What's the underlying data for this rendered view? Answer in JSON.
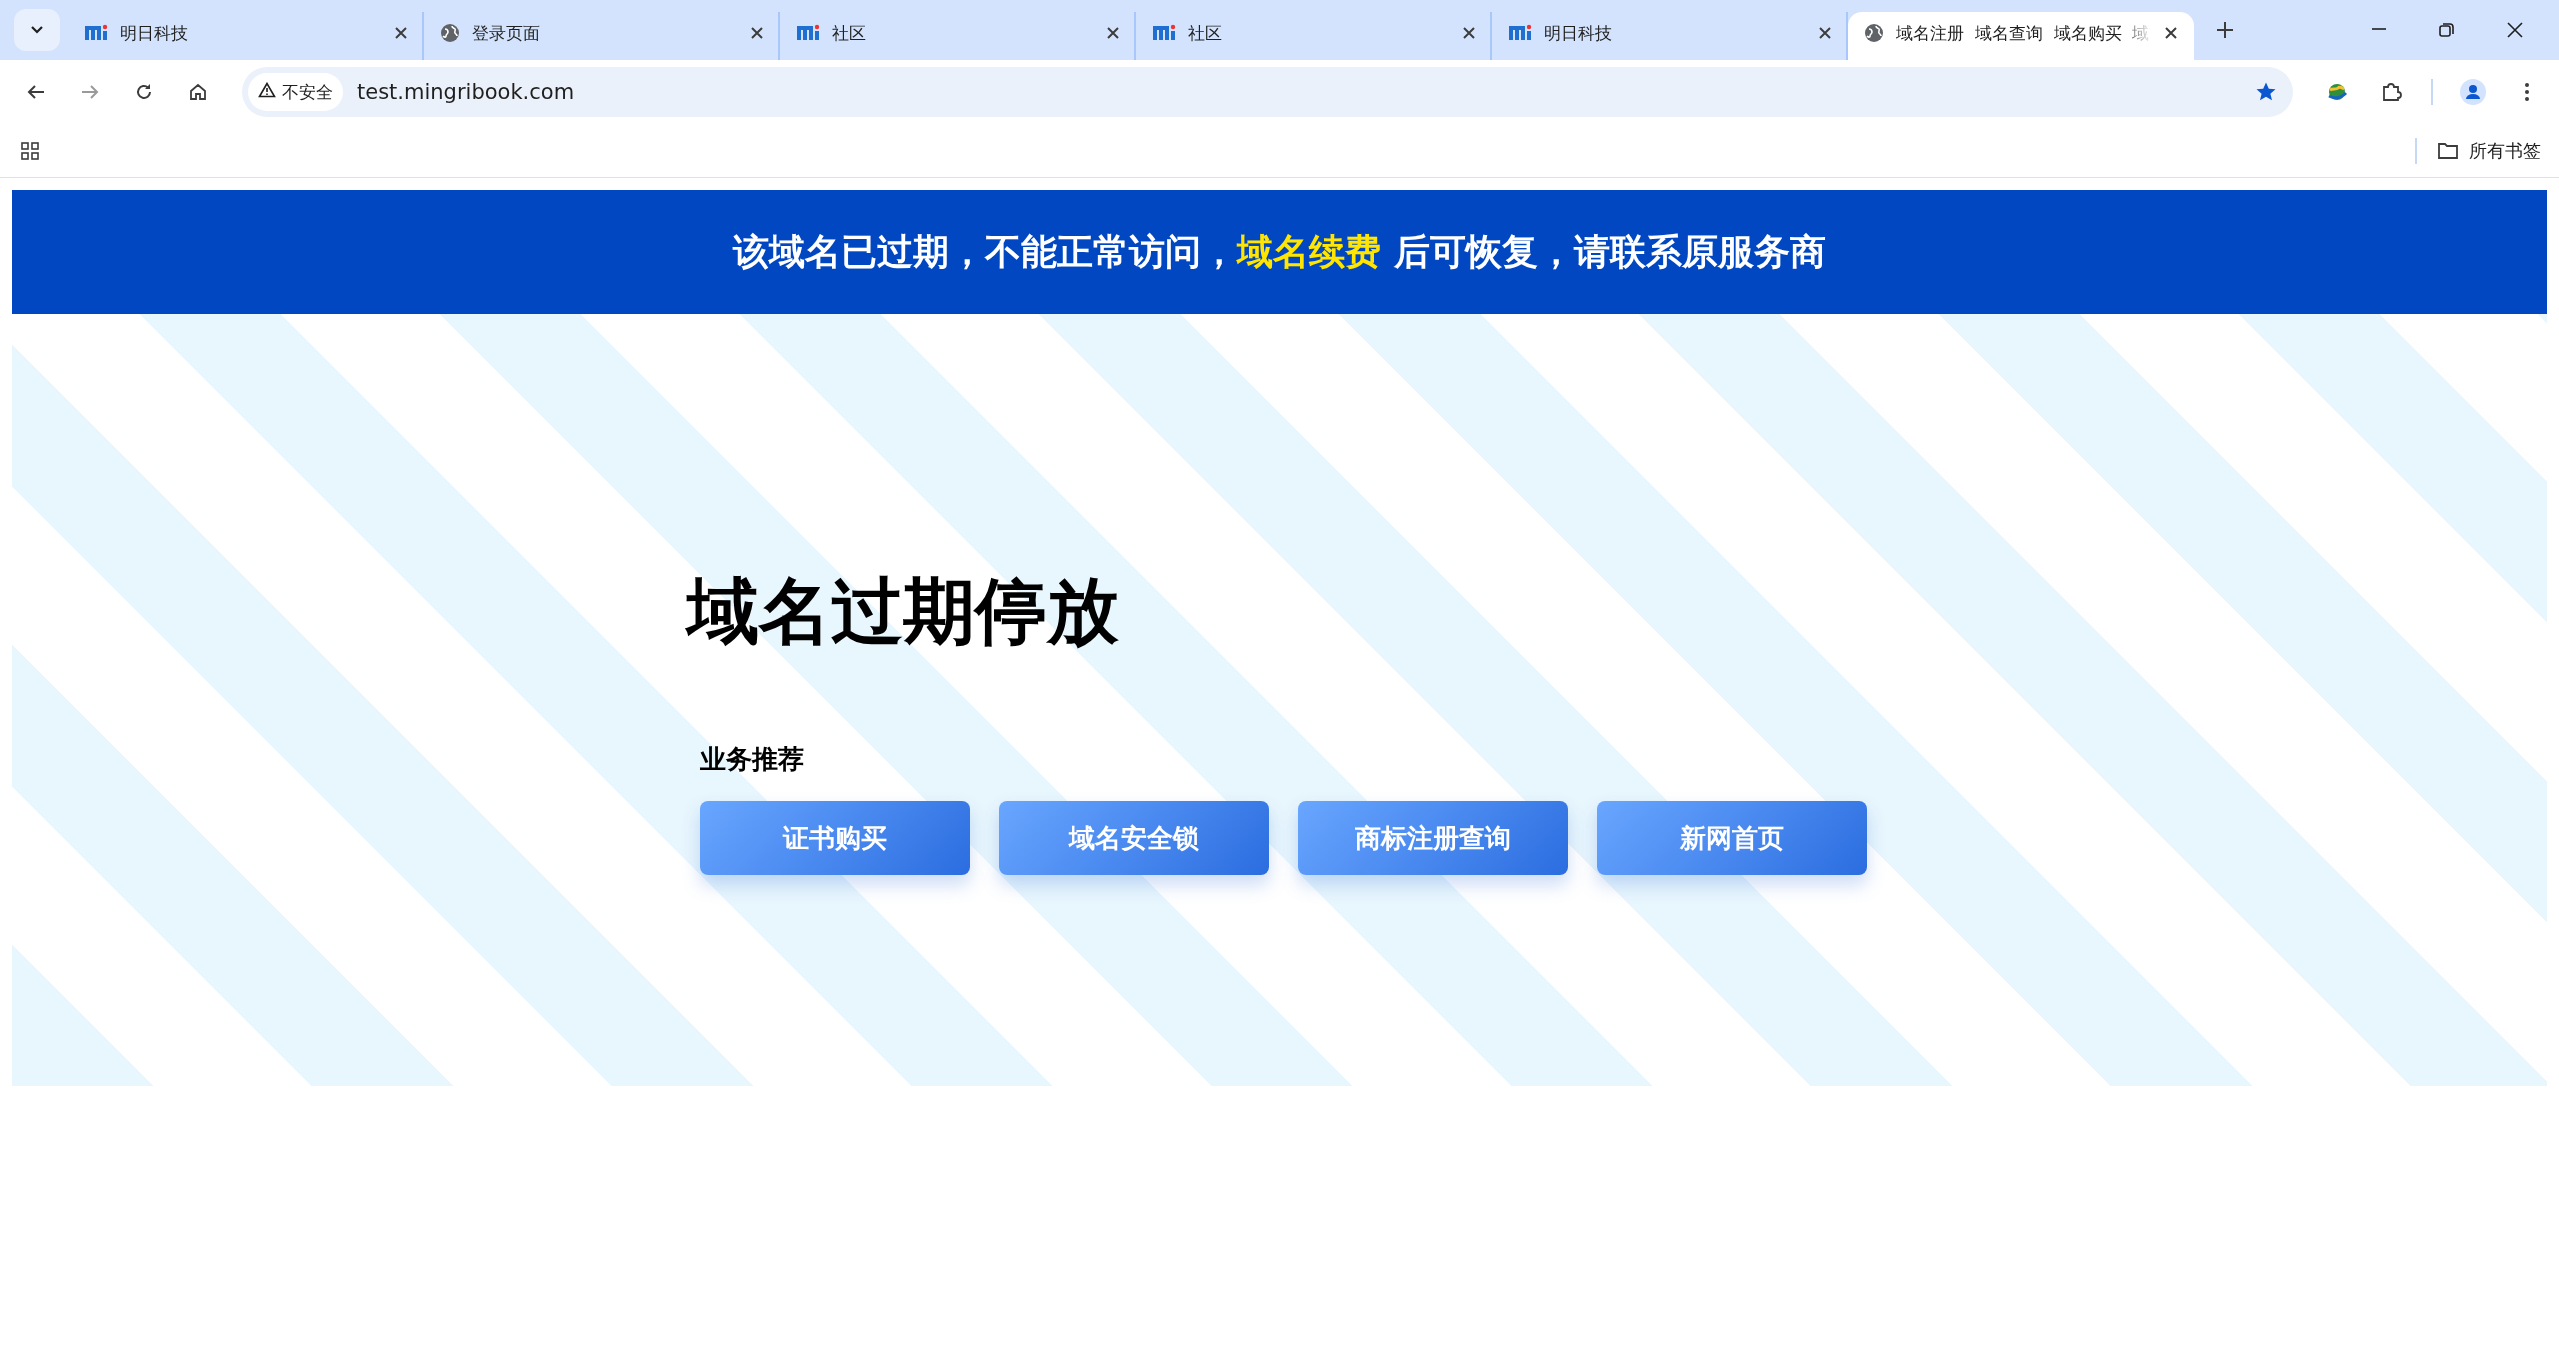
{
  "browser": {
    "tabs": [
      {
        "kind": "logo",
        "title": "明日科技",
        "selected": false
      },
      {
        "kind": "globe",
        "title": "登录页面",
        "selected": false
      },
      {
        "kind": "logo",
        "title": "社区",
        "selected": false
      },
      {
        "kind": "logo",
        "title": "社区",
        "selected": false
      },
      {
        "kind": "logo",
        "title": "明日科技",
        "selected": false
      },
      {
        "kind": "globe",
        "title": "域名注册  域名查询  域名购买  域",
        "selected": true
      }
    ],
    "security_label": "不安全",
    "url": "test.mingribook.com",
    "bookmarked": true,
    "bookmarks_folder": "所有书签"
  },
  "banner": {
    "parts": [
      {
        "text": "该域名已过期，不能正常访问，",
        "highlight": false
      },
      {
        "text": "域名续费",
        "highlight": true
      },
      {
        "text": " 后可恢复，请联系原服务商",
        "highlight": false
      }
    ]
  },
  "heading": "域名过期停放",
  "section_title": "业务推荐",
  "buttons": [
    "证书购买",
    "域名安全锁",
    "商标注册查询",
    "新网首页"
  ]
}
